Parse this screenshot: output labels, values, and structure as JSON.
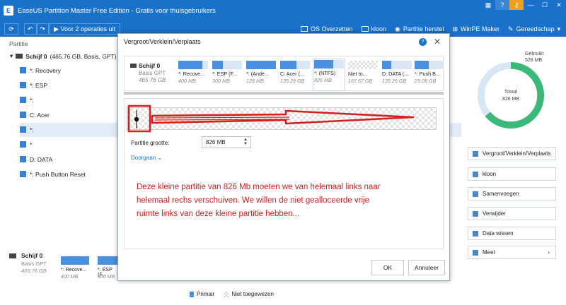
{
  "window": {
    "title": "EaseUS Partition Master Free Edition - Gratis voor thuisgebruikers",
    "help_label": "?",
    "key_label": "⚷",
    "min_label": "—",
    "max_label": "☐",
    "close_label": "✕"
  },
  "toolbar": {
    "back_label": "↶",
    "forward_label": "↷",
    "pending_label": "Voor 2 operaties uit",
    "items": [
      {
        "label": "OS Overzetten"
      },
      {
        "label": "kloon"
      },
      {
        "label": "Partitie herstel"
      },
      {
        "label": "WinPE Maker"
      },
      {
        "label": "Gereedschap"
      }
    ]
  },
  "left": {
    "column_header": "Partitie",
    "disk_label": "Schijf 0",
    "disk_meta": "(465.76 GB, Basis, GPT)",
    "partitions": [
      {
        "label": "*: Recovery"
      },
      {
        "label": "*: ESP"
      },
      {
        "label": "*:"
      },
      {
        "label": "C: Acer"
      },
      {
        "label": "*:"
      },
      {
        "label": "*"
      },
      {
        "label": "D: DATA"
      },
      {
        "label": "*: Push Button Reset"
      }
    ]
  },
  "right": {
    "used_label": "Gebruikt",
    "used_value": "528 MB",
    "total_label": "Totaal",
    "total_value": "826 MB",
    "used_fraction": 0.64,
    "actions": [
      {
        "label": "Vergroot/Verklein/Verplaats"
      },
      {
        "label": "kloon"
      },
      {
        "label": "Samenvoegen"
      },
      {
        "label": "Verwijder"
      },
      {
        "label": "Data wissen"
      },
      {
        "label": "Meel"
      }
    ]
  },
  "bottom": {
    "disk_label": "Schijf 0",
    "disk_type": "Basis GPT",
    "disk_size": "465.76 GB",
    "parts": [
      {
        "name": "*: Recove...",
        "size": "400 MB"
      },
      {
        "name": "*: ESP (F...",
        "size": "300 MB"
      }
    ],
    "legend_primary": "Primair",
    "legend_unalloc": "Niet toegewezen"
  },
  "dialog": {
    "title": "Vergroot/Verklein/Verplaats",
    "help_label": "?",
    "close_label": "✕",
    "disk_label": "Schijf 0",
    "disk_type": "Basis GPT",
    "disk_size": "465.76 GB",
    "partitions": [
      {
        "name": "*: Recove...",
        "size": "400 MB"
      },
      {
        "name": "*: ESP (F...",
        "size": "300 MB"
      },
      {
        "name": "*: (Ande...",
        "size": "128 MB"
      },
      {
        "name": "C: Acer (...",
        "size": "135.29 GB"
      },
      {
        "name": "*: (NTFS)",
        "size": "826 MB"
      },
      {
        "name": "Niet to...",
        "size": "167.67 GB"
      },
      {
        "name": "D: DATA (...",
        "size": "135.26 GB"
      },
      {
        "name": "*: Push B...",
        "size": "25.09 GB"
      }
    ],
    "size_label": "Partitie grootte:",
    "size_value": "826 MB",
    "more_label": "Doorgaan",
    "note": "Deze kleine partitie van 826 Mb moeten we van helemaal links naar helemaal rechs verschuiven. We willen de niet gealloceerde vrije ruimte links van deze kleine partitie hebben...",
    "ok_label": "OK",
    "cancel_label": "Annuleer"
  },
  "colors": {
    "brand_blue": "#1a71c9",
    "partition_blue": "#4a90e2",
    "used_green": "#3cb878",
    "annotation_red": "#d22020"
  }
}
